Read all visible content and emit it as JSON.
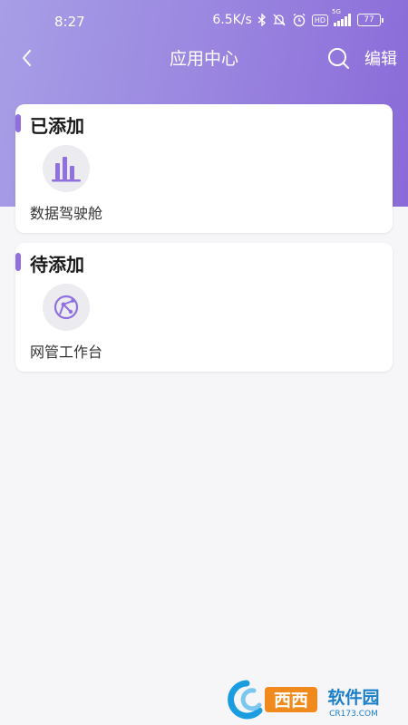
{
  "status_bar": {
    "time": "8:27",
    "speed": "6.5K/s",
    "battery": "77",
    "network": "5G",
    "hd": "HD"
  },
  "navbar": {
    "title": "应用中心",
    "edit_label": "编辑",
    "icons": {
      "back": "chevron-left-icon",
      "search": "search-icon"
    }
  },
  "sections": {
    "added": {
      "title": "已添加",
      "items": [
        {
          "label": "数据驾驶舱",
          "icon": "bar-chart-icon"
        }
      ]
    },
    "pending": {
      "title": "待添加",
      "items": [
        {
          "label": "网管工作台",
          "icon": "network-globe-icon"
        }
      ]
    }
  },
  "watermark": {
    "brand": "西西",
    "text": "软件园",
    "domain": "CR173.COM"
  },
  "colors": {
    "accent": "#8f70de",
    "header_start": "#a79ee6",
    "header_end": "#8a6ad8",
    "background": "#f6f6f8"
  }
}
